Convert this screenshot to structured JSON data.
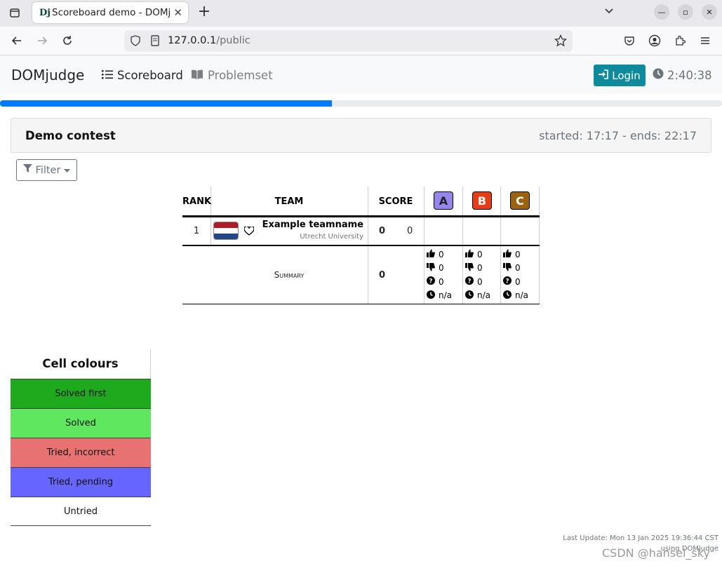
{
  "browser": {
    "tab_title": "Scoreboard demo - DOMjudge",
    "tab_favicon": "Dj",
    "url_host": "127.0.0.1",
    "url_path": "/public"
  },
  "navbar": {
    "brand": "DOMjudge",
    "links": [
      {
        "label": "Scoreboard",
        "icon": "list-icon"
      },
      {
        "label": "Problemset",
        "icon": "book-icon"
      }
    ],
    "login_label": "Login",
    "clock": "2:40:38"
  },
  "progress_percent": 46,
  "contest": {
    "name": "Demo contest",
    "times": "started: 17:17 - ends: 22:17"
  },
  "filter_label": "Filter",
  "scoreboard": {
    "headers": {
      "rank": "RANK",
      "team": "TEAM",
      "score": "SCORE"
    },
    "problems": [
      {
        "label": "A",
        "color": "#9486ea"
      },
      {
        "label": "B",
        "color": "#e33e17"
      },
      {
        "label": "C",
        "color": "#9b6210"
      }
    ],
    "teams": [
      {
        "rank": "1",
        "name": "Example teamname",
        "affiliation": "Utrecht University",
        "solved": "0",
        "penalty": "0"
      }
    ],
    "summary": {
      "label": "Summary",
      "score": "0",
      "per_problem": [
        {
          "correct": "0",
          "incorrect": "0",
          "pending": "0",
          "first": "n/a"
        },
        {
          "correct": "0",
          "incorrect": "0",
          "pending": "0",
          "first": "n/a"
        },
        {
          "correct": "0",
          "incorrect": "0",
          "pending": "0",
          "first": "n/a"
        }
      ]
    }
  },
  "legend": {
    "title": "Cell colours",
    "items": [
      {
        "label": "Solved first",
        "color": "#1daa1d"
      },
      {
        "label": "Solved",
        "color": "#60e760"
      },
      {
        "label": "Tried, incorrect",
        "color": "#e87272"
      },
      {
        "label": "Tried, pending",
        "color": "#6666ff"
      },
      {
        "label": "Untried",
        "color": "#ffffff"
      }
    ]
  },
  "footer": {
    "last_update": "Last Update: Mon 13 Jan 2025 19:36:44 CST",
    "using": "using DOMjudge"
  },
  "watermark": "CSDN @hansel_sky"
}
